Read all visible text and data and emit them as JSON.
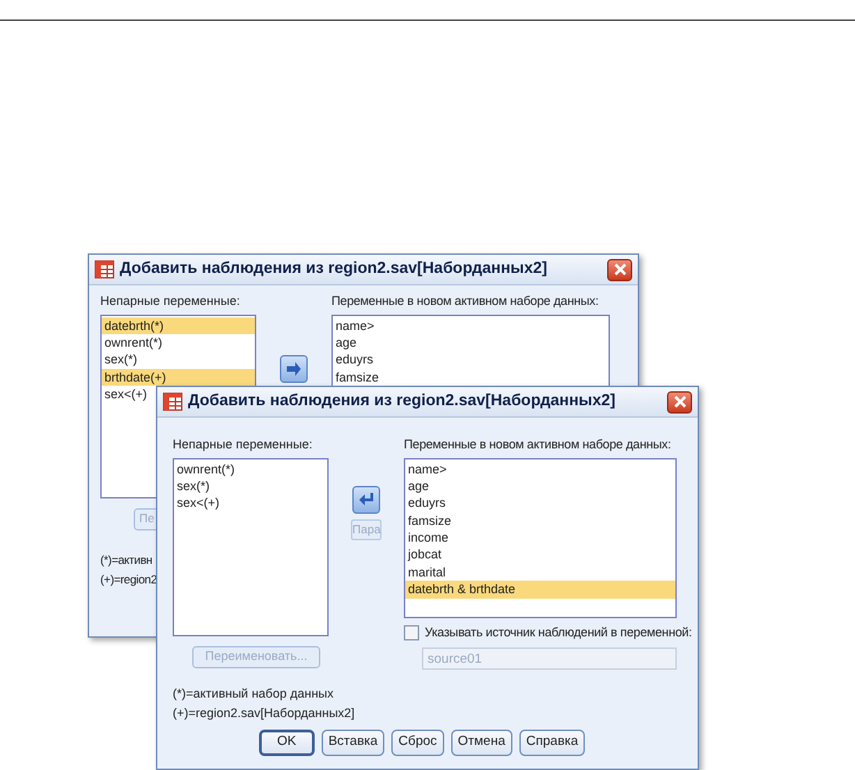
{
  "dialogs": [
    {
      "title": "Добавить наблюдения из region2.sav[Наборданных2]",
      "front": false,
      "left_label": "Непарные переменные:",
      "left_items": [
        {
          "text": "datebrth(*)",
          "selected": true
        },
        {
          "text": "ownrent(*)",
          "selected": false
        },
        {
          "text": "sex(*)",
          "selected": false
        },
        {
          "text": "brthdate(+)",
          "selected": true
        },
        {
          "text": "sex<(+)",
          "selected": false
        }
      ],
      "right_label": "Переменные в новом активном наборе данных:",
      "right_items": [
        {
          "text": "name>"
        },
        {
          "text": "age"
        },
        {
          "text": "eduyrs"
        },
        {
          "text": "famsize"
        }
      ],
      "rename_button": {
        "label": "Пе",
        "disabled": true
      },
      "legend": [
        "(*)=активн",
        "(+)=region2"
      ]
    },
    {
      "title": "Добавить наблюдения из region2.sav[Наборданных2]",
      "front": true,
      "left_label": "Непарные переменные:",
      "left_items": [
        {
          "text": "ownrent(*)",
          "selected": false
        },
        {
          "text": "sex(*)",
          "selected": false
        },
        {
          "text": "sex<(+)",
          "selected": false
        }
      ],
      "pair_button": {
        "label": "Пара",
        "disabled": true
      },
      "right_label": "Переменные в новом активном наборе данных:",
      "right_items": [
        {
          "text": "name>",
          "selected": false
        },
        {
          "text": "age",
          "selected": false
        },
        {
          "text": "eduyrs",
          "selected": false
        },
        {
          "text": "famsize",
          "selected": false
        },
        {
          "text": "income",
          "selected": false
        },
        {
          "text": "jobcat",
          "selected": false
        },
        {
          "text": "marital",
          "selected": false
        },
        {
          "text": "datebrth & brthdate",
          "selected": true
        }
      ],
      "source_checkbox": {
        "label": "Указывать источник наблюдений в переменной:",
        "checked": false
      },
      "source_field": {
        "value": "source01",
        "disabled": true
      },
      "rename_button": {
        "label": "Переименовать...",
        "disabled": true
      },
      "legend": [
        "(*)=активный набор данных",
        "(+)=region2.sav[Наборданных2]"
      ],
      "buttons": [
        {
          "label": "OK",
          "default": true
        },
        {
          "label": "Вставка",
          "default": false
        },
        {
          "label": "Сброс",
          "default": false
        },
        {
          "label": "Отмена",
          "default": false
        },
        {
          "label": "Справка",
          "default": false
        }
      ]
    }
  ]
}
